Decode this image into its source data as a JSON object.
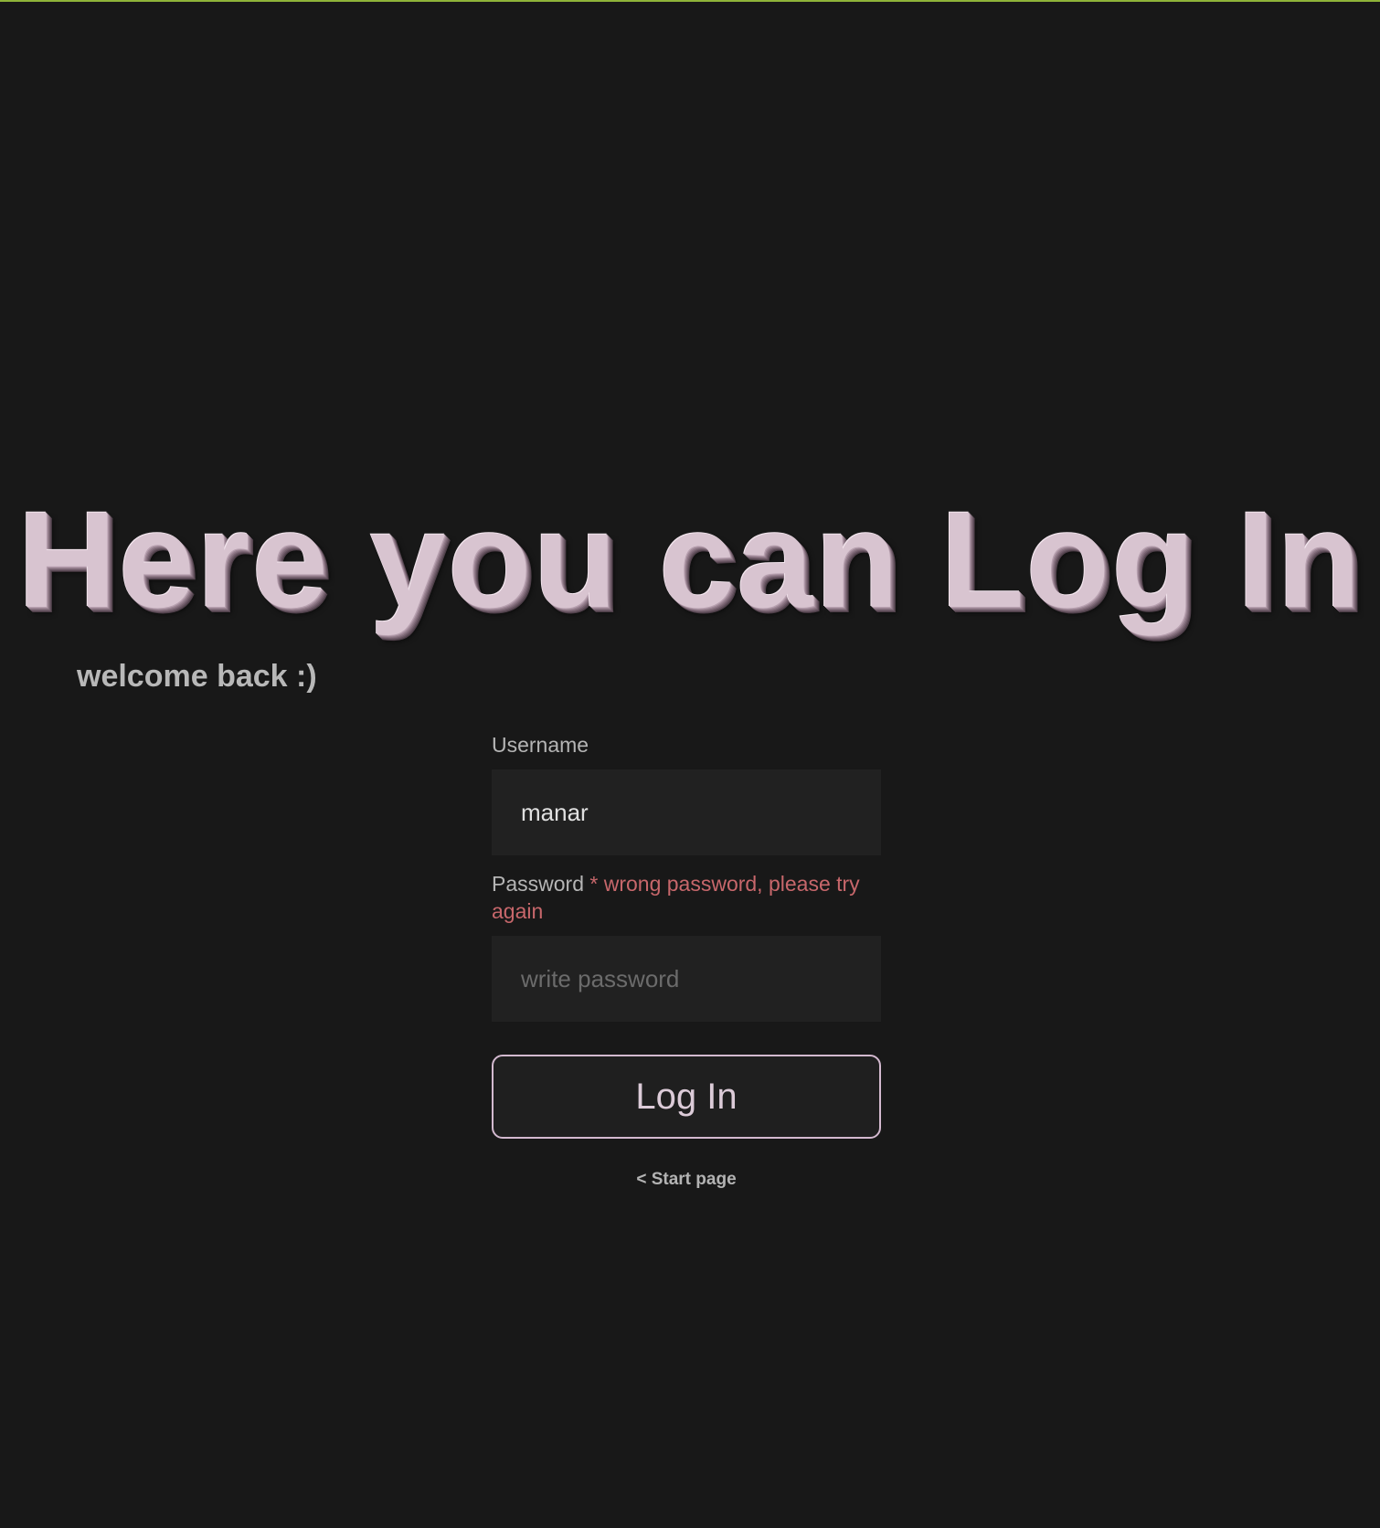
{
  "header": {
    "title": "Here you can Log In",
    "subtitle": "welcome back :)"
  },
  "form": {
    "username_label": "Username",
    "username_value": "manar",
    "password_label": "Password",
    "password_error": "* wrong password, please try again",
    "password_placeholder": "write password",
    "submit_label": "Log In"
  },
  "nav": {
    "start_page_link": "< Start page"
  },
  "colors": {
    "background": "#181818",
    "accent_top_bar": "#8fb339",
    "title": "#d8c4d0",
    "error": "#c7676b",
    "button_border": "#d3b9cf"
  }
}
